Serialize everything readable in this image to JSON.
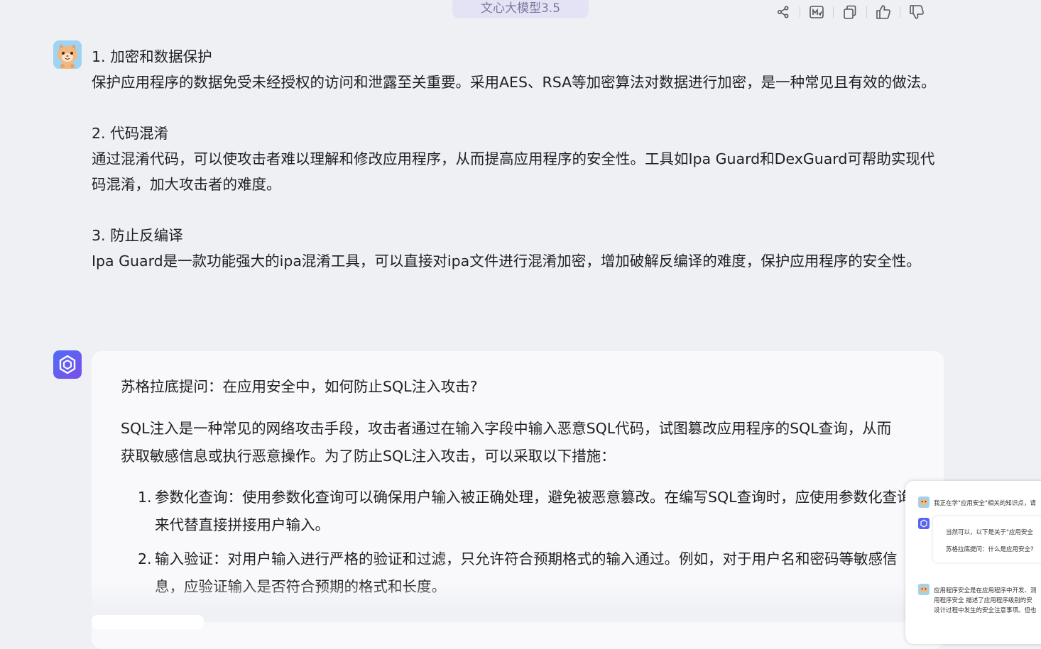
{
  "model_tag": "文心大模型3.5",
  "toolbar": {
    "icons": [
      "share-icon",
      "markdown-icon",
      "copy-icon",
      "thumbs-up-icon",
      "thumbs-down-icon"
    ]
  },
  "user_message": {
    "sections": [
      {
        "heading": "1. 加密和数据保护",
        "body": "保护应用程序的数据免受未经授权的访问和泄露至关重要。采用AES、RSA等加密算法对数据进行加密，是一种常见且有效的做法。"
      },
      {
        "heading": "2. 代码混淆",
        "body": "通过混淆代码，可以使攻击者难以理解和修改应用程序，从而提高应用程序的安全性。工具如Ipa Guard和DexGuard可帮助实现代码混淆，加大攻击者的难度。"
      },
      {
        "heading": "3. 防止反编译",
        "body": "Ipa Guard是一款功能强大的ipa混淆工具，可以直接对ipa文件进行混淆加密，增加破解反编译的难度，保护应用程序的安全性。"
      }
    ]
  },
  "assistant_message": {
    "question": "苏格拉底提问：在应用安全中，如何防止SQL注入攻击?",
    "intro": "SQL注入是一种常见的网络攻击手段，攻击者通过在输入字段中输入恶意SQL代码，试图篡改应用程序的SQL查询，从而获取敏感信息或执行恶意操作。为了防止SQL注入攻击，可以采取以下措施：",
    "items": [
      {
        "num": "1.",
        "text": "参数化查询：使用参数化查询可以确保用户输入被正确处理，避免被恶意篡改。在编写SQL查询时，应使用参数化查询来代替直接拼接用户输入。"
      },
      {
        "num": "2.",
        "text": "输入验证：对用户输入进行严格的验证和过滤，只允许符合预期格式的输入通过。例如，对于用户名和密码等敏感信息，应验证输入是否符合预期的格式和长度。"
      }
    ]
  },
  "preview": {
    "line1": "我正在学\"应用安全\"相关的知识点，请",
    "bubble1": "当然可以，以下是关于\"应用安全",
    "bubble2": "苏格拉底提问：什么是应用安全?",
    "para1": "应用程序安全是在应用程序中开发、测",
    "para2": "用程序安全 描述了应用程序级别的安",
    "para3": "设计过程中发生的安全注意事项。但也"
  }
}
